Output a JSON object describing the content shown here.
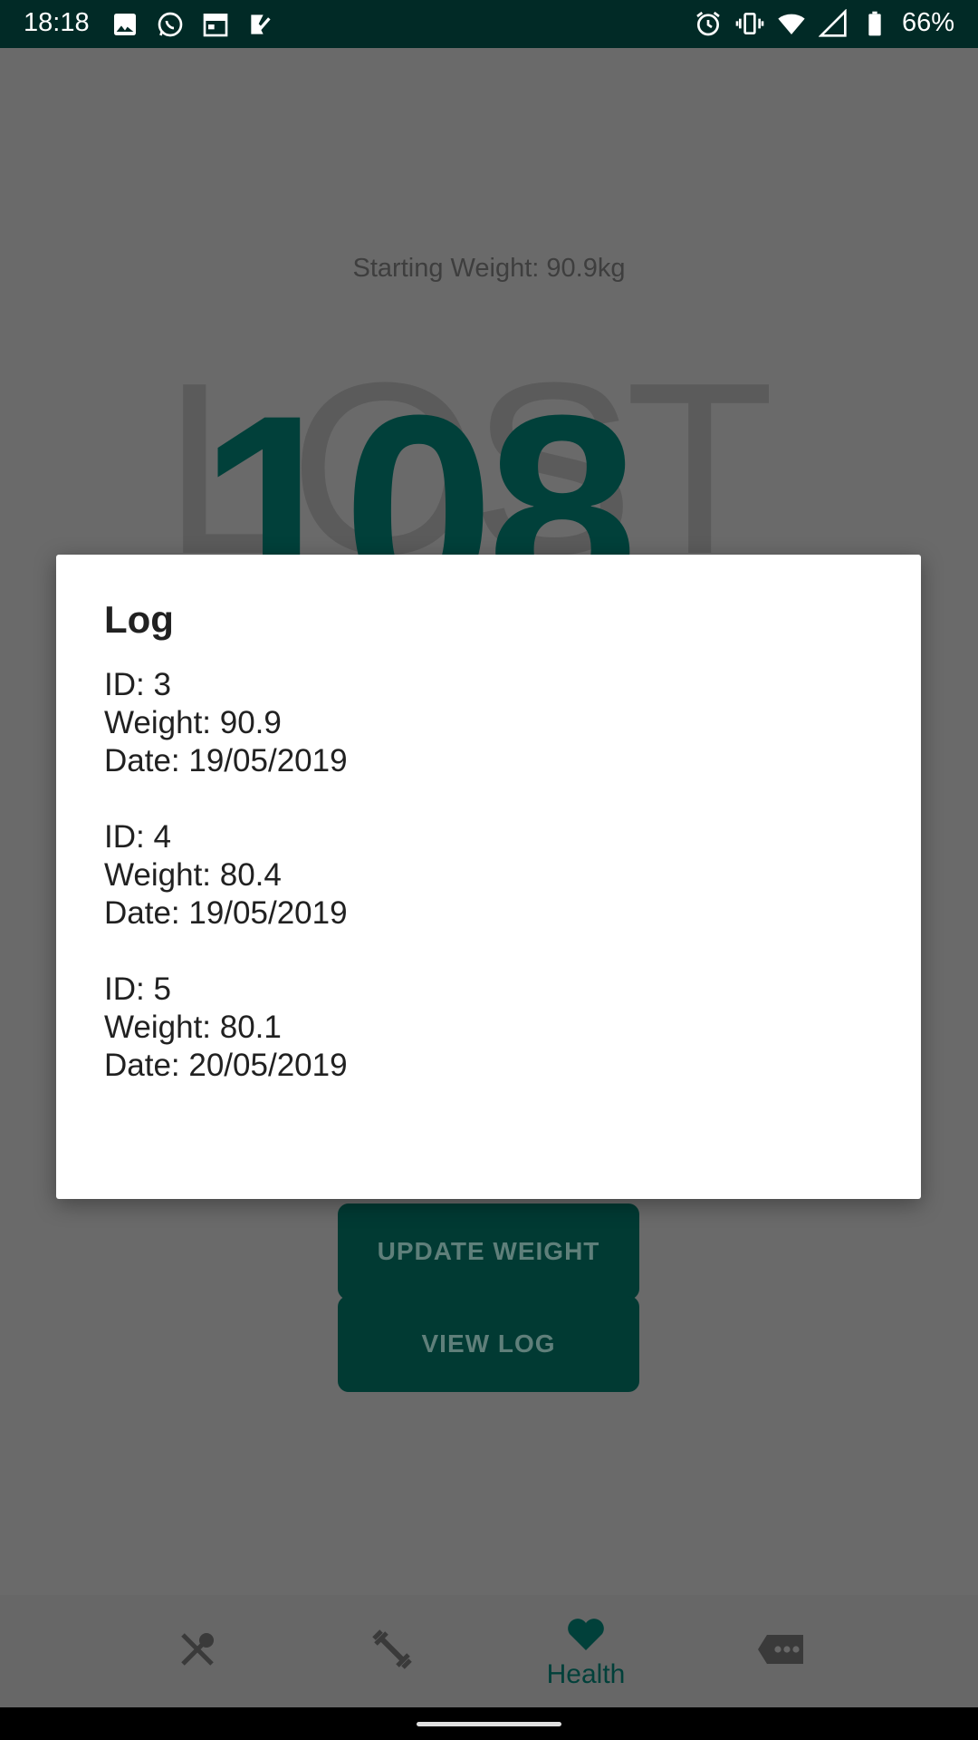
{
  "status_bar": {
    "time": "18:18",
    "battery": "66%",
    "left_icons": [
      "image-icon",
      "whatsapp-icon",
      "calendar-icon",
      "tasks-icon"
    ],
    "right_icons": [
      "alarm-icon",
      "vibrate-icon",
      "wifi-icon",
      "signal-icon",
      "battery-icon"
    ]
  },
  "background": {
    "starting_weight": "Starting Weight: 90.9kg",
    "big_number": "108",
    "big_text": "LOST",
    "update_button": "UPDATE WEIGHT",
    "view_log_button": "VIEW LOG"
  },
  "bottom_nav": {
    "items": [
      {
        "icon": "food-icon",
        "label": ""
      },
      {
        "icon": "dumbbell-icon",
        "label": ""
      },
      {
        "icon": "heart-icon",
        "label": "Health"
      },
      {
        "icon": "more-tag-icon",
        "label": ""
      }
    ],
    "active_color": "#01403a"
  },
  "dialog": {
    "title": "Log",
    "entries": [
      {
        "id": "ID: 3",
        "weight": "Weight: 90.9",
        "date": "Date: 19/05/2019"
      },
      {
        "id": "ID: 4",
        "weight": "Weight: 80.4",
        "date": "Date: 19/05/2019"
      },
      {
        "id": "ID: 5",
        "weight": "Weight: 80.1",
        "date": "Date: 20/05/2019"
      }
    ]
  },
  "colors": {
    "status_bar": "#012a26",
    "primary": "#01403a",
    "scrim": "#6a6a6a"
  }
}
